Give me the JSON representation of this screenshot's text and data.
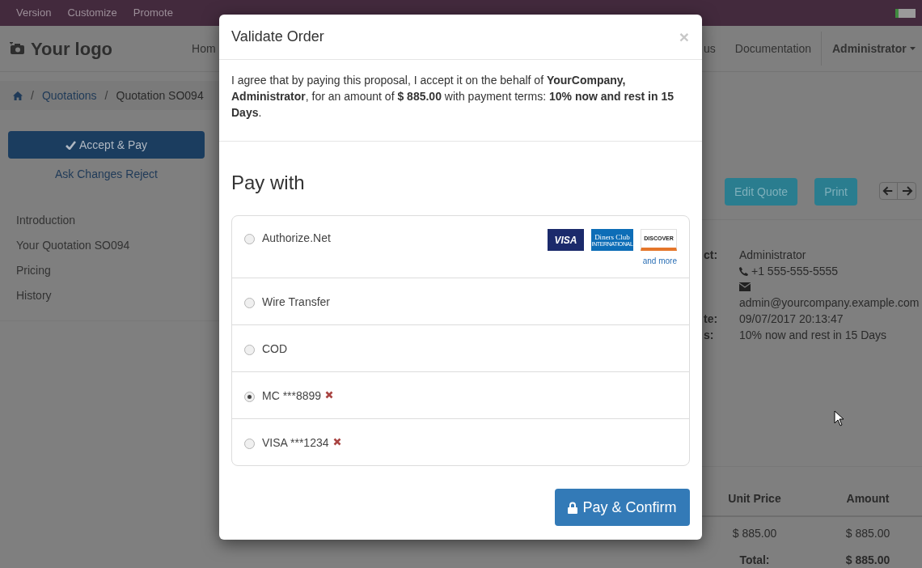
{
  "top_bar": {
    "items": [
      "Version",
      "Customize",
      "Promote"
    ]
  },
  "navbar": {
    "logo": "Your logo",
    "left_links": [
      "Hom"
    ],
    "right_links": [
      "us",
      "Documentation"
    ],
    "user": "Administrator"
  },
  "breadcrumb": {
    "separator": "/",
    "items": [
      {
        "label": "Quotations",
        "link": true
      },
      {
        "label": "Quotation SO094",
        "link": false
      }
    ]
  },
  "actions": {
    "accept": "Accept & Pay",
    "links": [
      "Ask Changes",
      "Reject"
    ]
  },
  "sidebar": {
    "items": [
      "Introduction",
      "Your Quotation SO094",
      "Pricing",
      "History"
    ]
  },
  "toolbar": {
    "buttons": [
      "Edit Quote",
      "Print"
    ]
  },
  "info": [
    {
      "kind": "text",
      "label": "ct:",
      "value": "Administrator"
    },
    {
      "kind": "phone",
      "value": "+1 555-555-5555"
    },
    {
      "kind": "email",
      "value": "admin@yourcompany.example.com"
    },
    {
      "kind": "text",
      "label": "te:",
      "value": "09/07/2017 20:13:47"
    },
    {
      "kind": "text",
      "label": "s:",
      "value": "10% now and rest in 15 Days"
    }
  ],
  "table": {
    "columns": [
      "Unit Price",
      "Amount"
    ],
    "rows": [
      [
        "$ 885.00",
        "$ 885.00"
      ]
    ],
    "total": {
      "label": "Total:",
      "value": "$ 885.00"
    }
  },
  "modal": {
    "title": "Validate Order",
    "close": "×",
    "message": "I agree that by paying this proposal, I accept it on the behalf of **YourCompany, Administrator**, for an amount of **$ 885.00** with payment terms: **10% now and rest in 15 Days**.",
    "heading": "Pay with",
    "methods": [
      {
        "kind": "acquirer",
        "label": "Authorize.Net",
        "selected": false,
        "cards": [
          {
            "kind": "visa",
            "text": [
              "VISA"
            ]
          },
          {
            "kind": "diners",
            "text": [
              "Diners Club",
              "INTERNATIONAL"
            ]
          },
          {
            "kind": "discover",
            "text": [
              "DISCOVER"
            ]
          }
        ],
        "more": "and more"
      },
      {
        "kind": "acquirer",
        "label": "Wire Transfer",
        "selected": false
      },
      {
        "kind": "acquirer",
        "label": "COD",
        "selected": false
      },
      {
        "kind": "token",
        "label": "MC ***8899",
        "selected": true
      },
      {
        "kind": "token",
        "label": "VISA ***1234",
        "selected": false
      }
    ],
    "confirm": "Pay & Confirm"
  }
}
